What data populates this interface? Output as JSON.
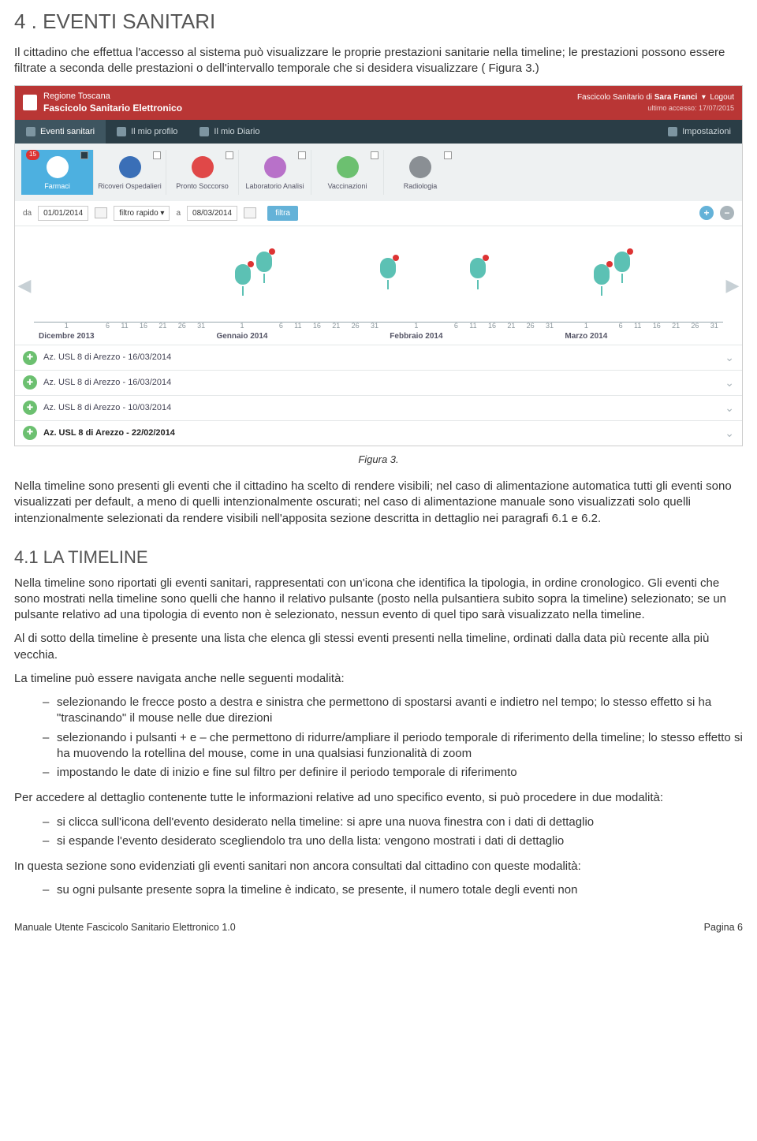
{
  "heading": "4 . EVENTI SANITARI",
  "intro": "Il cittadino che effettua l'accesso al sistema può visualizzare le proprie prestazioni sanitarie nella timeline; le prestazioni possono essere filtrate a seconda delle prestazioni o dell'intervallo temporale che si desidera visualizzare ( Figura 3.)",
  "caption": "Figura 3.",
  "para2": "Nella timeline sono presenti gli eventi che il cittadino ha scelto di rendere visibili; nel caso di alimentazione automatica tutti gli eventi sono visualizzati per default, a meno di quelli intenzionalmente oscurati; nel caso di alimentazione manuale sono visualizzati solo quelli intenzionalmente selezionati  da rendere visibili nell'apposita sezione descritta in dettaglio nei paragrafi 6.1 e 6.2.",
  "sub_heading": "4.1 LA TIMELINE",
  "sub_para1": "Nella timeline sono riportati gli eventi sanitari, rappresentati con un'icona che identifica la tipologia, in ordine cronologico. Gli eventi che sono mostrati nella timeline sono quelli che hanno il relativo pulsante (posto nella pulsantiera subito sopra la timeline) selezionato; se un pulsante relativo ad una tipologia di evento non è selezionato, nessun evento di quel tipo sarà visualizzato nella timeline.",
  "sub_para1b": "Al di sotto della timeline è presente una lista che elenca gli stessi eventi presenti nella timeline, ordinati dalla data più recente alla più vecchia.",
  "nav_intro": "La timeline può essere navigata anche nelle seguenti modalità:",
  "nav_items": [
    "selezionando le frecce posto a destra e sinistra che permettono di spostarsi avanti e indietro nel tempo; lo stesso effetto si ha \"trascinando\" il mouse nelle due direzioni",
    "selezionando i pulsanti + e – che permettono di ridurre/ampliare il periodo temporale di riferimento della timeline; lo stesso effetto si ha muovendo la rotellina del mouse, come in una qualsiasi funzionalità di zoom",
    "impostando le date di inizio e fine sul filtro per definire il periodo temporale di riferimento"
  ],
  "detail_intro": "Per accedere al dettaglio contenente tutte le informazioni relative ad uno specifico evento, si può procedere in due modalità:",
  "detail_items": [
    "si clicca sull'icona dell'evento desiderato nella timeline: si apre una nuova finestra con i dati di dettaglio",
    "si espande l'evento desiderato scegliendolo tra uno della lista: vengono mostrati i dati di dettaglio"
  ],
  "highlight_intro": "In questa sezione sono evidenziati gli eventi sanitari non ancora consultati dal cittadino con queste modalità:",
  "highlight_items": [
    "su ogni pulsante presente sopra la timeline è indicato, se presente, il numero totale degli eventi non"
  ],
  "footer_left": "Manuale Utente Fascicolo Sanitario Elettronico 1.0",
  "footer_right": "Pagina 6",
  "app": {
    "header": {
      "region": "Regione Toscana",
      "title": "Fascicolo Sanitario Elettronico",
      "owner_prefix": "Fascicolo Sanitario di ",
      "owner": "Sara Franci",
      "logout": "Logout",
      "last_access": "ultimo accesso: 17/07/2015"
    },
    "tabs": {
      "eventi": "Eventi sanitari",
      "profilo": "Il mio profilo",
      "diario": "Il mio Diario",
      "impostazioni": "Impostazioni"
    },
    "filters": [
      {
        "label": "Farmaci",
        "color": "#4db0e0",
        "selected": true,
        "badge": "15"
      },
      {
        "label": "Ricoveri Ospedalieri",
        "color": "#3a6fb7",
        "selected": false
      },
      {
        "label": "Pronto Soccorso",
        "color": "#e04848",
        "selected": false
      },
      {
        "label": "Laboratorio Analisi",
        "color": "#b871c9",
        "selected": false
      },
      {
        "label": "Vaccinazioni",
        "color": "#6cc070",
        "selected": false
      },
      {
        "label": "Radiologia",
        "color": "#8a8f94",
        "selected": false
      }
    ],
    "datebar": {
      "da": "da",
      "from": "01/01/2014",
      "rapid": "filtro rapido",
      "a": "a",
      "to": "08/03/2014",
      "filtra": "filtra"
    },
    "months": [
      "Dicembre 2013",
      "Gennaio 2014",
      "Febbraio 2014",
      "Marzo 2014"
    ],
    "day_ticks": [
      "1",
      "6",
      "11",
      "16",
      "21",
      "26",
      "31"
    ],
    "events": [
      {
        "text": "Az. USL 8 di Arezzo - 16/03/2014",
        "bold": false
      },
      {
        "text": "Az. USL 8 di Arezzo - 16/03/2014",
        "bold": false
      },
      {
        "text": "Az. USL 8 di Arezzo - 10/03/2014",
        "bold": false
      },
      {
        "text": "Az. USL 8 di Arezzo - 22/02/2014",
        "bold": true
      }
    ]
  }
}
